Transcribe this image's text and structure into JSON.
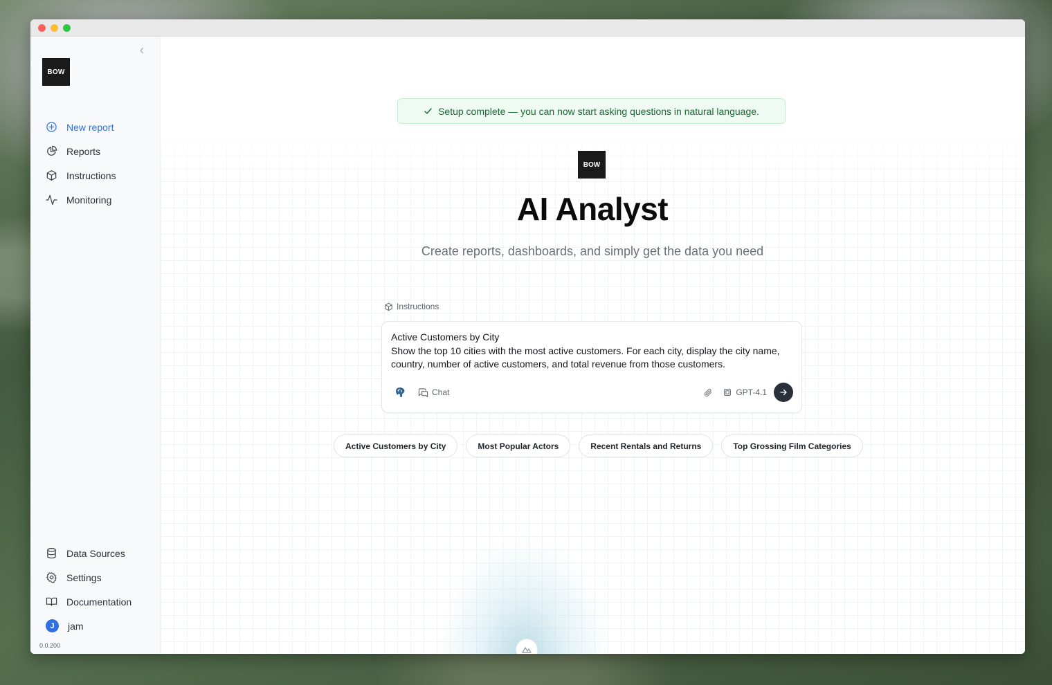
{
  "sidebar": {
    "logo_text": "BOW",
    "top_items": [
      {
        "label": "New report",
        "icon": "plus-circle-icon",
        "active": true
      },
      {
        "label": "Reports",
        "icon": "pie-chart-icon"
      },
      {
        "label": "Instructions",
        "icon": "cube-icon"
      },
      {
        "label": "Monitoring",
        "icon": "activity-icon"
      }
    ],
    "bottom_items": [
      {
        "label": "Data Sources",
        "icon": "database-icon"
      },
      {
        "label": "Settings",
        "icon": "gear-icon"
      },
      {
        "label": "Documentation",
        "icon": "book-icon"
      }
    ],
    "user": {
      "initial": "J",
      "name": "jam"
    },
    "version": "0.0.200"
  },
  "main": {
    "banner": "Setup complete — you can now start asking questions in natural language.",
    "logo_text": "BOW",
    "title": "AI Analyst",
    "subtitle": "Create reports, dashboards, and simply get the data you need",
    "instructions_label": "Instructions",
    "prompt": {
      "line1": "Active Customers by City",
      "line2": "Show the top 10 cities with the most active customers. For each city, display the city name, country, number of active customers, and total revenue from those customers.",
      "mode_label": "Chat",
      "model_label": "GPT-4.1"
    },
    "suggestions": [
      "Active Customers by City",
      "Most Popular Actors",
      "Recent Rentals and Returns",
      "Top Grossing Film Categories"
    ]
  },
  "colors": {
    "accent": "#2f6fe0",
    "banner_bg": "#effaf2",
    "banner_text": "#176a34",
    "send_button": "#2a2f3a"
  }
}
